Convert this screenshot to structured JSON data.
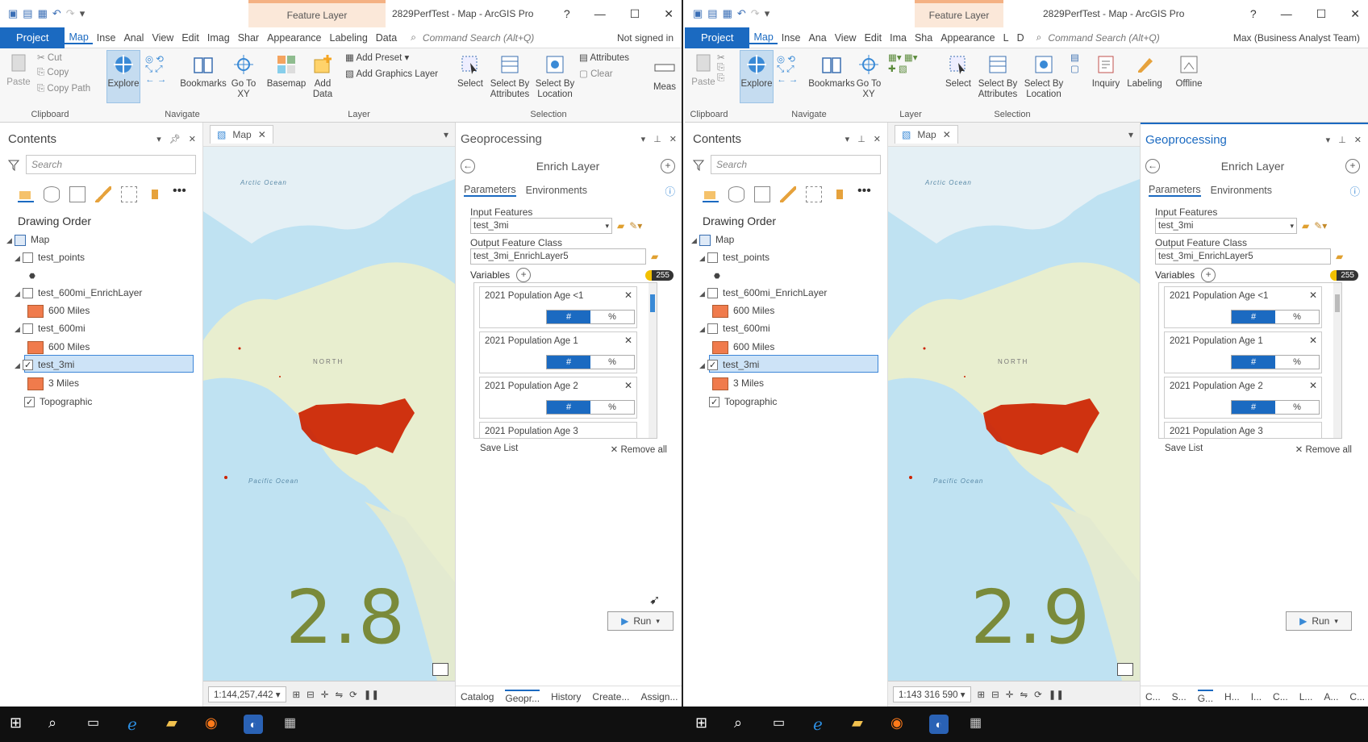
{
  "left": {
    "title": "2829PerfTest - Map - ArcGIS Pro",
    "context_tab": "Feature Layer",
    "ribbon_tabs": [
      "Project",
      "Map",
      "Inse",
      "Anal",
      "View",
      "Edit",
      "Imag",
      "Shar",
      "Appearance",
      "Labeling",
      "Data"
    ],
    "command_search": "Command Search (Alt+Q)",
    "user": "Not signed in",
    "ribbon": {
      "cut": "Cut",
      "copy": "Copy",
      "copy_path": "Copy Path",
      "paste": "Paste",
      "clipboard": "Clipboard",
      "explore": "Explore",
      "bookmarks": "Bookmarks",
      "goto": "Go To XY",
      "navigate": "Navigate",
      "basemap": "Basemap",
      "add_data": "Add Data",
      "add_preset": "Add Preset",
      "add_graphics": "Add Graphics Layer",
      "layer": "Layer",
      "select": "Select",
      "select_attr": "Select By Attributes",
      "select_loc": "Select By Location",
      "attributes": "Attributes",
      "clear": "Clear",
      "selection": "Selection",
      "measure": "Meas"
    },
    "contents": {
      "title": "Contents",
      "search": "Search",
      "drawing_order": "Drawing Order",
      "items": [
        "Map",
        "test_points",
        "test_600mi_EnrichLayer",
        "600 Miles",
        "test_600mi",
        "600 Miles",
        "test_3mi",
        "3 Miles",
        "Topographic"
      ]
    },
    "map": {
      "tab": "Map",
      "scale": "1:144,257,442",
      "version": "2.8",
      "labels": {
        "arctic": "Arctic Ocean",
        "pacific": "Pacific Ocean",
        "north": "NORTH"
      }
    },
    "gp": {
      "title": "Geoprocessing",
      "tool": "Enrich Layer",
      "tab_params": "Parameters",
      "tab_env": "Environments",
      "input_label": "Input Features",
      "input_value": "test_3mi",
      "output_label": "Output Feature Class",
      "output_value": "test_3mi_EnrichLayer5",
      "variables_label": "Variables",
      "badge": "255",
      "vars": [
        "2021 Population Age <1",
        "2021 Population Age 1",
        "2021 Population Age 2",
        "2021 Population Age 3"
      ],
      "hash": "#",
      "pct": "%",
      "save_list": "Save List",
      "remove_all": "Remove all",
      "run": "Run",
      "bottom_tabs": [
        "Catalog",
        "Geopr...",
        "History",
        "Create...",
        "Assign..."
      ]
    }
  },
  "right": {
    "title": "2829PerfTest - Map - ArcGIS Pro",
    "context_tab": "Feature Layer",
    "ribbon_tabs": [
      "Project",
      "Map",
      "Inse",
      "Ana",
      "View",
      "Edit",
      "Ima",
      "Sha",
      "Appearance",
      "L",
      "D"
    ],
    "command_search": "Command Search (Alt+Q)",
    "user": "Max (Business Analyst Team)",
    "ribbon": {
      "paste": "Paste",
      "clipboard": "Clipboard",
      "explore": "Explore",
      "bookmarks": "Bookmarks",
      "goto": "Go To XY",
      "navigate": "Navigate",
      "layer": "Layer",
      "select": "Select",
      "select_attr": "Select By Attributes",
      "select_loc": "Select By Location",
      "selection": "Selection",
      "inquiry": "Inquiry",
      "labeling": "Labeling",
      "offline": "Offline"
    },
    "contents": {
      "title": "Contents",
      "search": "Search",
      "drawing_order": "Drawing Order",
      "items": [
        "Map",
        "test_points",
        "test_600mi_EnrichLayer",
        "600 Miles",
        "test_600mi",
        "600 Miles",
        "test_3mi",
        "3 Miles",
        "Topographic"
      ]
    },
    "map": {
      "tab": "Map",
      "scale": "1:143 316 590",
      "version": "2.9",
      "labels": {
        "arctic": "Arctic Ocean",
        "pacific": "Pacific Ocean",
        "north": "NORTH"
      }
    },
    "gp": {
      "title": "Geoprocessing",
      "tool": "Enrich Layer",
      "tab_params": "Parameters",
      "tab_env": "Environments",
      "input_label": "Input Features",
      "input_value": "test_3mi",
      "output_label": "Output Feature Class",
      "output_value": "test_3mi_EnrichLayer5",
      "variables_label": "Variables",
      "badge": "255",
      "vars": [
        "2021 Population Age <1",
        "2021 Population Age 1",
        "2021 Population Age 2",
        "2021 Population Age 3"
      ],
      "hash": "#",
      "pct": "%",
      "save_list": "Save List",
      "remove_all": "Remove all",
      "run": "Run",
      "bottom_tabs": [
        "C...",
        "S...",
        "G...",
        "H...",
        "I...",
        "C...",
        "L...",
        "A...",
        "C..."
      ]
    }
  },
  "colors": {
    "accent": "#1b6ac1",
    "swatch": "#f07b4c",
    "ocean": "#b9dff0",
    "land": "#e6ecd0",
    "points": "#cc2200",
    "version": "#7a8a3a"
  }
}
